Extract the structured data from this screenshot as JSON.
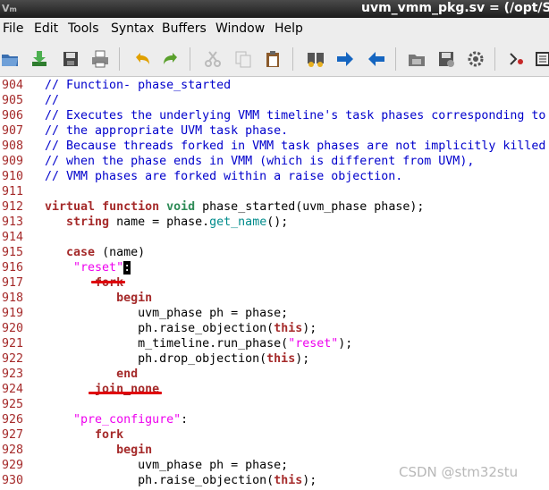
{
  "window": {
    "title": "uvm_vmm_pkg.sv = (/opt/Sy",
    "app_icon": "vim-icon"
  },
  "menu": [
    "File",
    "Edit",
    "Tools",
    "Syntax",
    "Buffers",
    "Window",
    "Help"
  ],
  "toolbar": [
    {
      "icon": "open-folder-icon"
    },
    {
      "icon": "download-icon"
    },
    {
      "icon": "save-icon"
    },
    {
      "icon": "print-icon"
    },
    {
      "icon": "undo-icon"
    },
    {
      "icon": "redo-icon"
    },
    {
      "icon": "cut-icon"
    },
    {
      "icon": "copy-icon"
    },
    {
      "icon": "paste-icon"
    },
    {
      "icon": "find-replace-icon"
    },
    {
      "icon": "forward-arrow-icon"
    },
    {
      "icon": "back-arrow-icon"
    },
    {
      "icon": "load-session-icon"
    },
    {
      "icon": "save-session-icon"
    },
    {
      "icon": "run-script-icon"
    },
    {
      "icon": "make-icon"
    },
    {
      "icon": "ctags-icon"
    }
  ],
  "editor": {
    "lines": [
      {
        "num": "904",
        "tokens": [
          {
            "c": "cm",
            "t": "// Function- phase_started"
          }
        ]
      },
      {
        "num": "905",
        "tokens": [
          {
            "c": "cm",
            "t": "//"
          }
        ]
      },
      {
        "num": "906",
        "tokens": [
          {
            "c": "cm",
            "t": "// Executes the underlying VMM timeline's task phases corresponding to"
          }
        ]
      },
      {
        "num": "907",
        "tokens": [
          {
            "c": "cm",
            "t": "// the appropriate UVM task phase."
          }
        ]
      },
      {
        "num": "908",
        "tokens": [
          {
            "c": "cm",
            "t": "// Because threads forked in VMM task phases are not implicitly killed"
          }
        ]
      },
      {
        "num": "909",
        "tokens": [
          {
            "c": "cm",
            "t": "// when the phase ends in VMM (which is different from UVM),"
          }
        ]
      },
      {
        "num": "910",
        "tokens": [
          {
            "c": "cm",
            "t": "// VMM phases are forked within a raise objection."
          }
        ]
      },
      {
        "num": "911",
        "tokens": []
      },
      {
        "num": "912",
        "tokens": [
          {
            "c": "kw",
            "t": "virtual"
          },
          {
            "c": "tx",
            "t": " "
          },
          {
            "c": "kw",
            "t": "function"
          },
          {
            "c": "tx",
            "t": " "
          },
          {
            "c": "dt",
            "t": "void"
          },
          {
            "c": "tx",
            "t": " phase_started("
          },
          {
            "c": "tx",
            "t": "uvm_phase phase"
          },
          {
            "c": "tx",
            "t": ");"
          }
        ]
      },
      {
        "num": "913",
        "tokens": [
          {
            "c": "tx",
            "t": "   "
          },
          {
            "c": "kw",
            "t": "string"
          },
          {
            "c": "tx",
            "t": " name = phase."
          },
          {
            "c": "fn",
            "t": "get_name"
          },
          {
            "c": "tx",
            "t": "();"
          }
        ]
      },
      {
        "num": "914",
        "tokens": []
      },
      {
        "num": "915",
        "tokens": [
          {
            "c": "tx",
            "t": "   "
          },
          {
            "c": "kw",
            "t": "case"
          },
          {
            "c": "tx",
            "t": " (name)"
          }
        ]
      },
      {
        "num": "916",
        "tokens": [
          {
            "c": "tx",
            "t": "    "
          },
          {
            "c": "st",
            "t": "\"reset\""
          },
          {
            "c": "cursor",
            "t": ":"
          }
        ]
      },
      {
        "num": "917",
        "tokens": [
          {
            "c": "tx",
            "t": "       "
          },
          {
            "c": "kw",
            "t": "fork"
          }
        ]
      },
      {
        "num": "918",
        "tokens": [
          {
            "c": "tx",
            "t": "          "
          },
          {
            "c": "kw",
            "t": "begin"
          }
        ]
      },
      {
        "num": "919",
        "tokens": [
          {
            "c": "tx",
            "t": "             uvm_phase ph = phase;"
          }
        ]
      },
      {
        "num": "920",
        "tokens": [
          {
            "c": "tx",
            "t": "             ph.raise_objection("
          },
          {
            "c": "kw",
            "t": "this"
          },
          {
            "c": "tx",
            "t": ");"
          }
        ]
      },
      {
        "num": "921",
        "tokens": [
          {
            "c": "tx",
            "t": "             m_timeline.run_phase("
          },
          {
            "c": "st",
            "t": "\"reset\""
          },
          {
            "c": "tx",
            "t": ");"
          }
        ]
      },
      {
        "num": "922",
        "tokens": [
          {
            "c": "tx",
            "t": "             ph.drop_objection("
          },
          {
            "c": "kw",
            "t": "this"
          },
          {
            "c": "tx",
            "t": ");"
          }
        ]
      },
      {
        "num": "923",
        "tokens": [
          {
            "c": "tx",
            "t": "          "
          },
          {
            "c": "kw",
            "t": "end"
          }
        ]
      },
      {
        "num": "924",
        "tokens": [
          {
            "c": "tx",
            "t": "       "
          },
          {
            "c": "kw",
            "t": "join_none"
          }
        ]
      },
      {
        "num": "925",
        "tokens": []
      },
      {
        "num": "926",
        "tokens": [
          {
            "c": "tx",
            "t": "    "
          },
          {
            "c": "st",
            "t": "\"pre_configure\""
          },
          {
            "c": "tx",
            "t": ":"
          }
        ]
      },
      {
        "num": "927",
        "tokens": [
          {
            "c": "tx",
            "t": "       "
          },
          {
            "c": "kw",
            "t": "fork"
          }
        ]
      },
      {
        "num": "928",
        "tokens": [
          {
            "c": "tx",
            "t": "          "
          },
          {
            "c": "kw",
            "t": "begin"
          }
        ]
      },
      {
        "num": "929",
        "tokens": [
          {
            "c": "tx",
            "t": "             uvm_phase ph = phase;"
          }
        ]
      },
      {
        "num": "930",
        "tokens": [
          {
            "c": "tx",
            "t": "             ph.raise_objection("
          },
          {
            "c": "kw",
            "t": "this"
          },
          {
            "c": "tx",
            "t": ");"
          }
        ]
      }
    ]
  },
  "watermark": "CSDN @stm32stu",
  "colors": {
    "comment": "#0000cc",
    "keyword": "#a52a2a",
    "string": "#ee00ee",
    "function": "#008b8b",
    "line_number": "#a52a2a",
    "annotation": "#e0000a"
  }
}
